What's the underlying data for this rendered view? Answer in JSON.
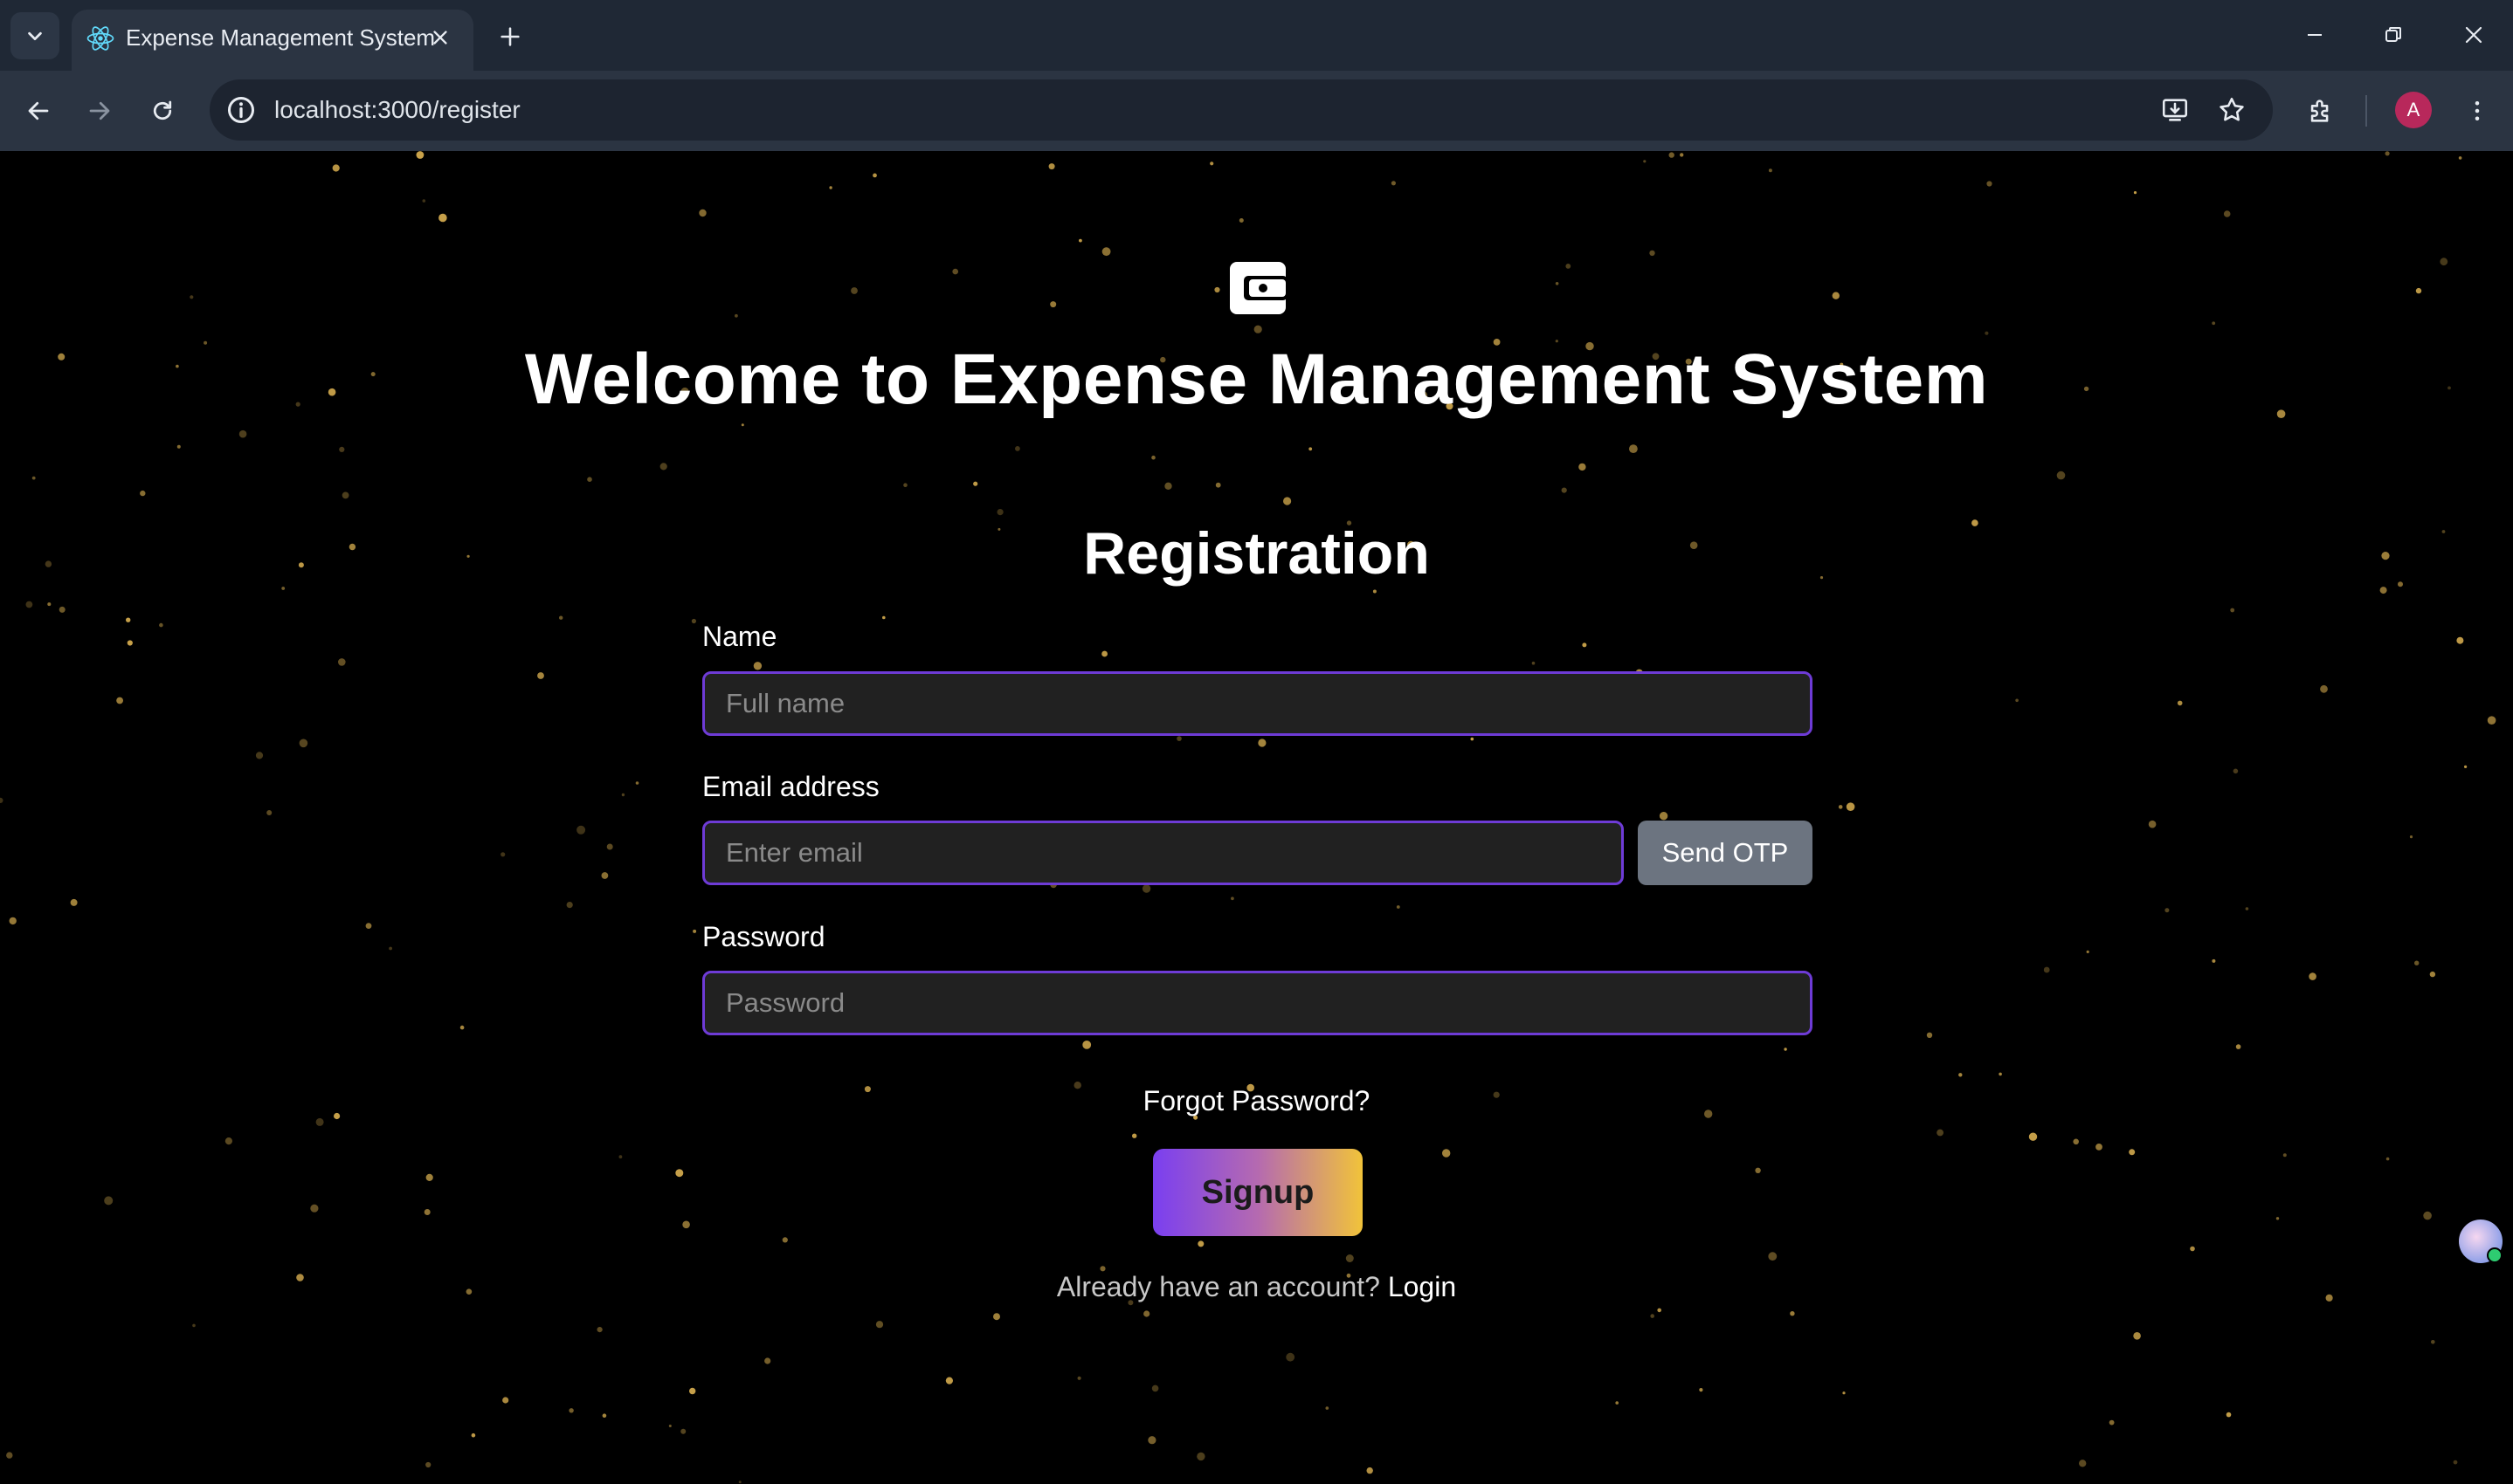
{
  "browser": {
    "tab_title": "Expense Management System",
    "url": "localhost:3000/register",
    "profile_initial": "A"
  },
  "page": {
    "welcome_heading": "Welcome to Expense Management System",
    "form_title": "Registration",
    "fields": {
      "name_label": "Name",
      "name_placeholder": "Full name",
      "name_value": "",
      "email_label": "Email address",
      "email_placeholder": "Enter email",
      "email_value": "",
      "password_label": "Password",
      "password_placeholder": "Password",
      "password_value": ""
    },
    "send_otp_label": "Send OTP",
    "forgot_password": "Forgot Password?",
    "signup_label": "Signup",
    "already_text": "Already have an account?",
    "login_link": "Login"
  },
  "colors": {
    "background": "#000000",
    "input_border": "#6e3bd6",
    "input_bg": "#212121",
    "signup_gradient_start": "#7a3ff0",
    "signup_gradient_end": "#f1c33a",
    "otp_button": "#6c7480",
    "star": "#c9a24a"
  },
  "icons": {
    "tab_favicon": "react-atom-icon",
    "app_logo": "wallet-icon"
  }
}
